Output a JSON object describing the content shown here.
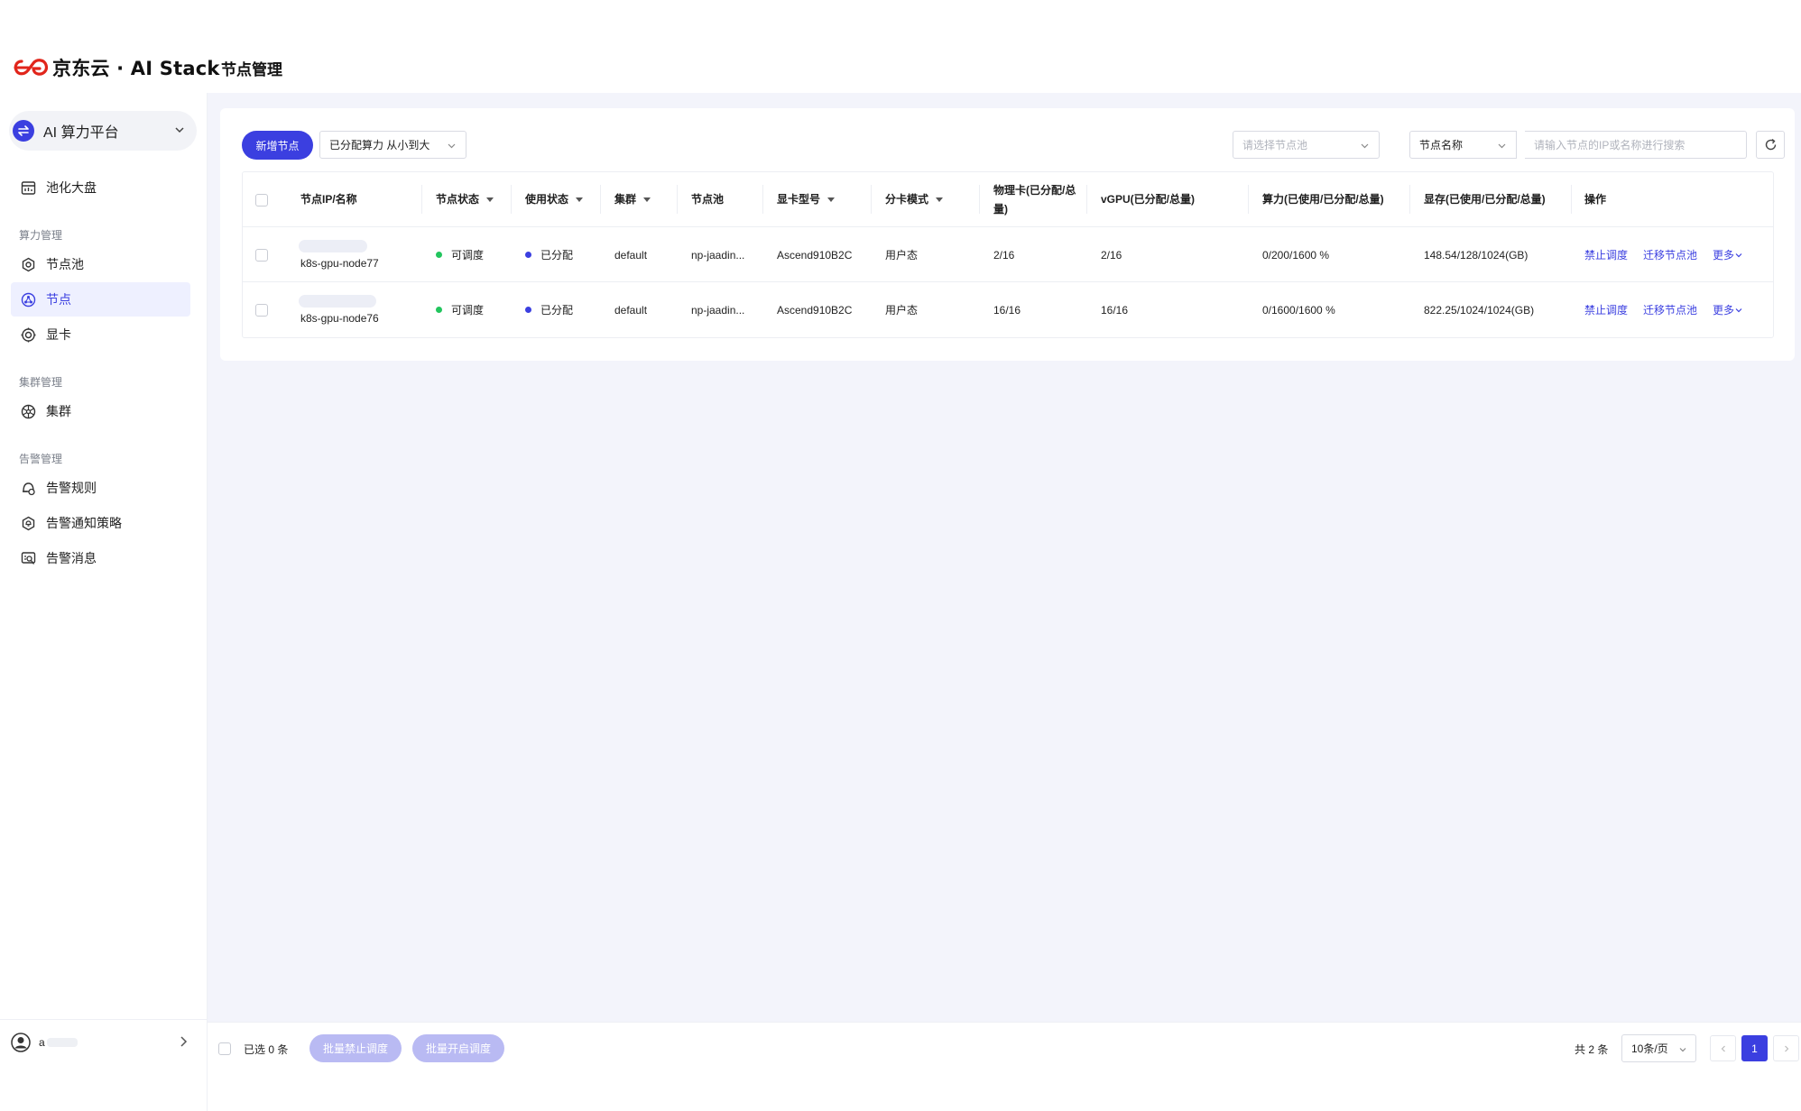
{
  "header": {
    "logo_text": "京东云 · AI Stack",
    "page_title": "节点管理"
  },
  "sidebar": {
    "platform": {
      "label": "AI 算力平台",
      "icon": "swap-icon"
    },
    "groups": [
      {
        "label": "算力管理"
      },
      {
        "label": "集群管理"
      },
      {
        "label": "告警管理"
      }
    ],
    "items": [
      {
        "label": "池化大盘",
        "icon": "dashboard-icon"
      },
      {
        "label": "节点池",
        "icon": "hexagon-gear-icon"
      },
      {
        "label": "节点",
        "icon": "node-icon",
        "active": true
      },
      {
        "label": "显卡",
        "icon": "gpu-icon"
      },
      {
        "label": "集群",
        "icon": "cluster-icon"
      },
      {
        "label": "告警规则",
        "icon": "alert-rule-icon"
      },
      {
        "label": "告警通知策略",
        "icon": "notify-policy-icon"
      },
      {
        "label": "告警消息",
        "icon": "alert-message-icon"
      }
    ],
    "user": {
      "name": "a"
    }
  },
  "toolbar": {
    "add_label": "新增节点",
    "sort_select": "已分配算力  从小到大",
    "pool_placeholder": "请选择节点池",
    "search_field": "节点名称",
    "search_placeholder": "请输入节点的IP或名称进行搜索"
  },
  "table": {
    "columns": [
      "节点IP/名称",
      "节点状态",
      "使用状态",
      "集群",
      "节点池",
      "显卡型号",
      "分卡模式",
      "物理卡(已分配/总量)",
      "vGPU(已分配/总量)",
      "算力(已使用/已分配/总量)",
      "显存(已使用/已分配/总量)",
      "操作"
    ],
    "rows": [
      {
        "name": "k8s-gpu-node77",
        "node_status": "可调度",
        "use_status": "已分配",
        "cluster": "default",
        "pool": "np-jaadin...",
        "gpu_model": "Ascend910B2C",
        "split_mode": "用户态",
        "physical": "2/16",
        "vgpu": "2/16",
        "compute": "0/200/1600 %",
        "memory": "148.54/128/1024(GB)",
        "actions": [
          "禁止调度",
          "迁移节点池",
          "更多"
        ]
      },
      {
        "name": "k8s-gpu-node76",
        "node_status": "可调度",
        "use_status": "已分配",
        "cluster": "default",
        "pool": "np-jaadin...",
        "gpu_model": "Ascend910B2C",
        "split_mode": "用户态",
        "physical": "16/16",
        "vgpu": "16/16",
        "compute": "0/1600/1600 %",
        "memory": "822.25/1024/1024(GB)",
        "actions": [
          "禁止调度",
          "迁移节点池",
          "更多"
        ]
      }
    ]
  },
  "footer": {
    "selected": "已选 0 条",
    "batch_disable": "批量禁止调度",
    "batch_enable": "批量开启调度",
    "total": "共 2 条",
    "page_size": "10条/页",
    "current_page": "1"
  },
  "colors": {
    "primary": "#3b3fe0",
    "status_ok": "#22c55e",
    "status_assigned": "#3b3fe0",
    "background": "#f3f4fb"
  }
}
